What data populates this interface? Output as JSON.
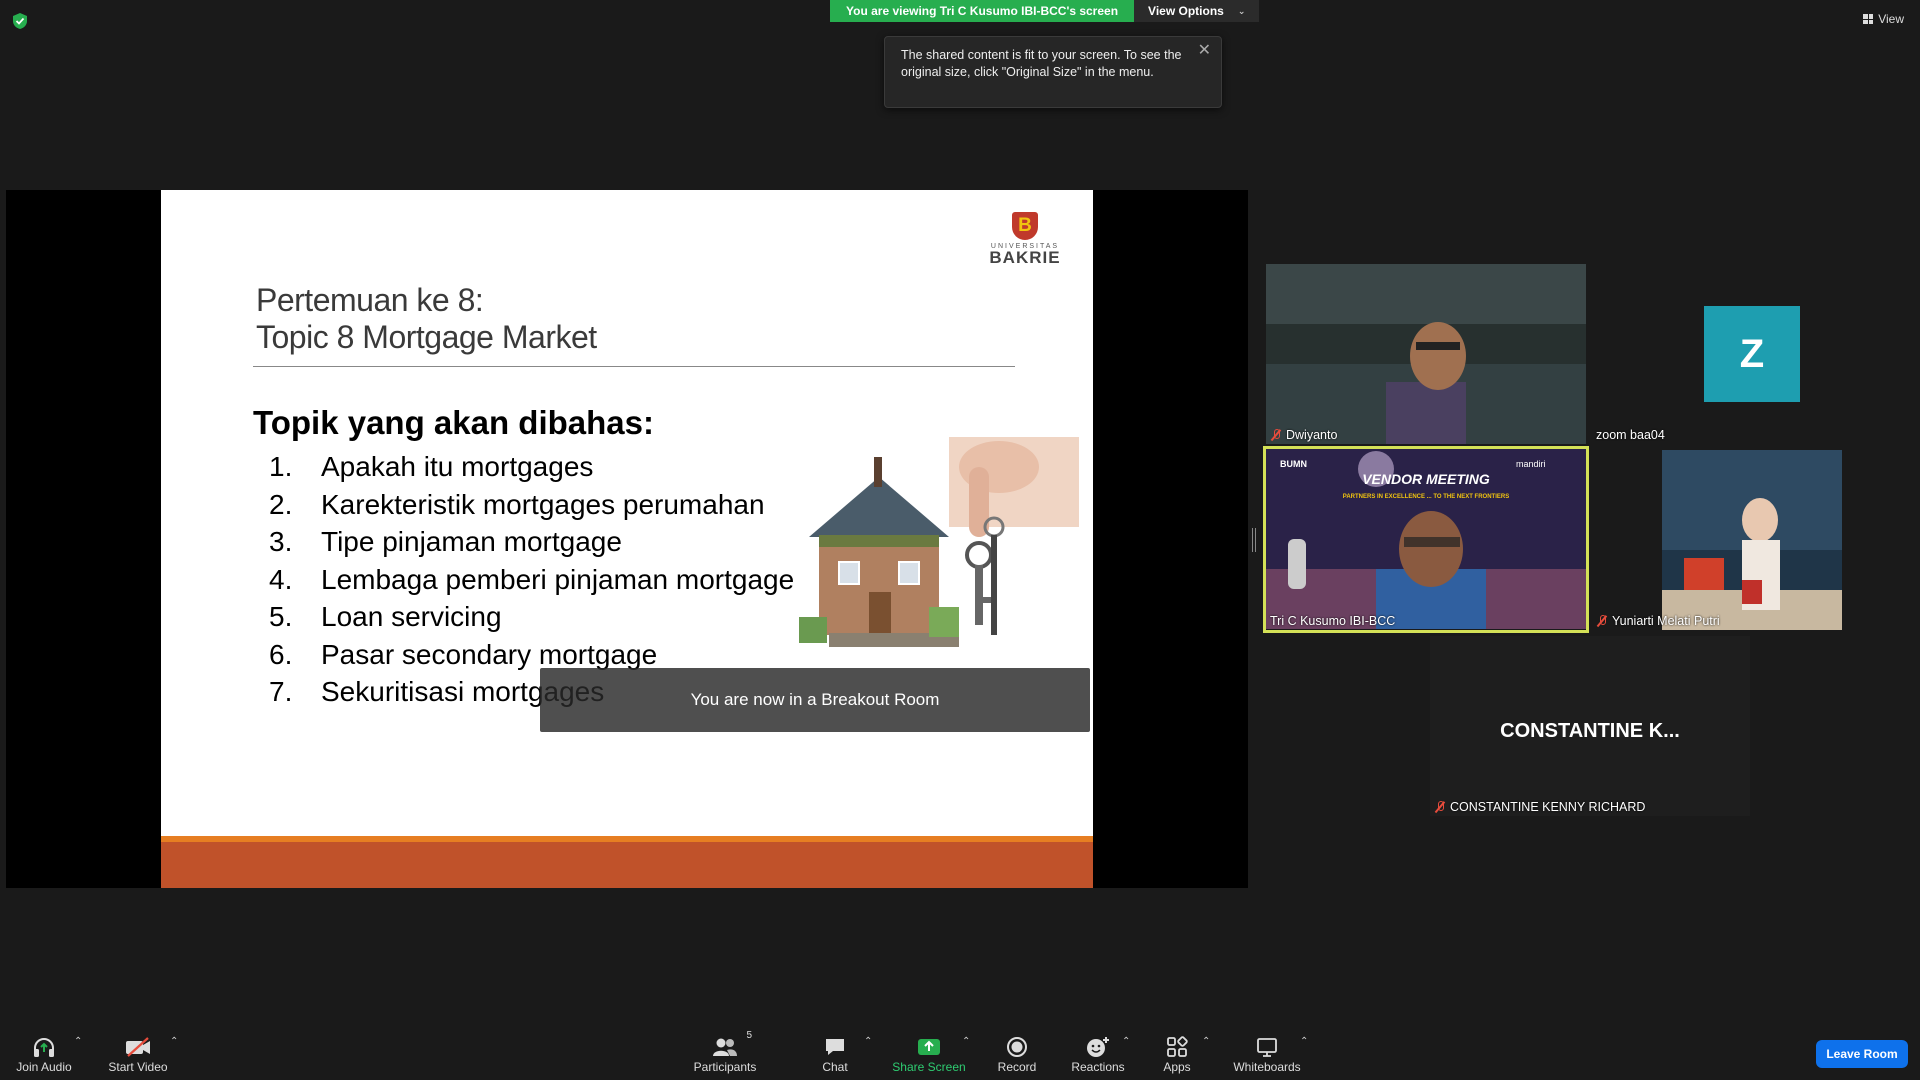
{
  "banner": {
    "viewing_text": "You are viewing Tri C Kusumo IBI-BCC's screen",
    "view_options": "View Options"
  },
  "top_right": {
    "view_label": "View"
  },
  "tooltip": {
    "text": "The shared content is fit to your screen. To see the original size, click \"Original Size\" in the menu."
  },
  "slide": {
    "logo": {
      "letter": "B",
      "line1": "UNIVERSITAS",
      "line2": "BAKRIE"
    },
    "title_line1": "Pertemuan ke 8:",
    "title_line2": "Topic 8 Mortgage Market",
    "topics_heading": "Topik yang akan dibahas:",
    "topics": [
      {
        "num": "1.",
        "text": "Apakah itu mortgages"
      },
      {
        "num": "2.",
        "text": "Karekteristik mortgages perumahan"
      },
      {
        "num": "3.",
        "text": "Tipe pinjaman mortgage"
      },
      {
        "num": "4.",
        "text": "Lembaga pemberi pinjaman mortgage"
      },
      {
        "num": "5.",
        "text": "Loan servicing"
      },
      {
        "num": "6.",
        "text": "Pasar secondary mortgage"
      },
      {
        "num": "7.",
        "text": "Sekuritisasi mortgages"
      }
    ]
  },
  "breakout_notice": "You are now in a Breakout Room",
  "participants": [
    {
      "name": "Dwiyanto",
      "muted": true
    },
    {
      "name": "zoom baa04",
      "avatar_letter": "Z",
      "muted": false
    },
    {
      "name": "Tri C Kusumo IBI-BCC",
      "muted": false,
      "active": true,
      "bg_text_1": "VENDOR MEETING",
      "bg_text_2": "PARTNERS IN EXCELLENCE ... TO THE NEXT FRONTIERS",
      "bg_brand_left": "BUMN",
      "bg_brand_right": "mandiri"
    },
    {
      "name": "Yuniarti Melati Putri",
      "muted": true
    },
    {
      "name": "CONSTANTINE KENNY RICHARD",
      "display_text": "CONSTANTINE  K...",
      "muted": true
    }
  ],
  "toolbar": {
    "join_audio": "Join Audio",
    "start_video": "Start Video",
    "participants": "Participants",
    "participants_count": "5",
    "chat": "Chat",
    "share_screen": "Share Screen",
    "record": "Record",
    "reactions": "Reactions",
    "apps": "Apps",
    "whiteboards": "Whiteboards",
    "leave_room": "Leave Room"
  },
  "colors": {
    "share_green": "#27ae4f",
    "leave_blue": "#0e71eb",
    "active_speaker": "#d4e157",
    "avatar_teal": "#1e9eb0",
    "slide_footer": "#c0522a"
  }
}
